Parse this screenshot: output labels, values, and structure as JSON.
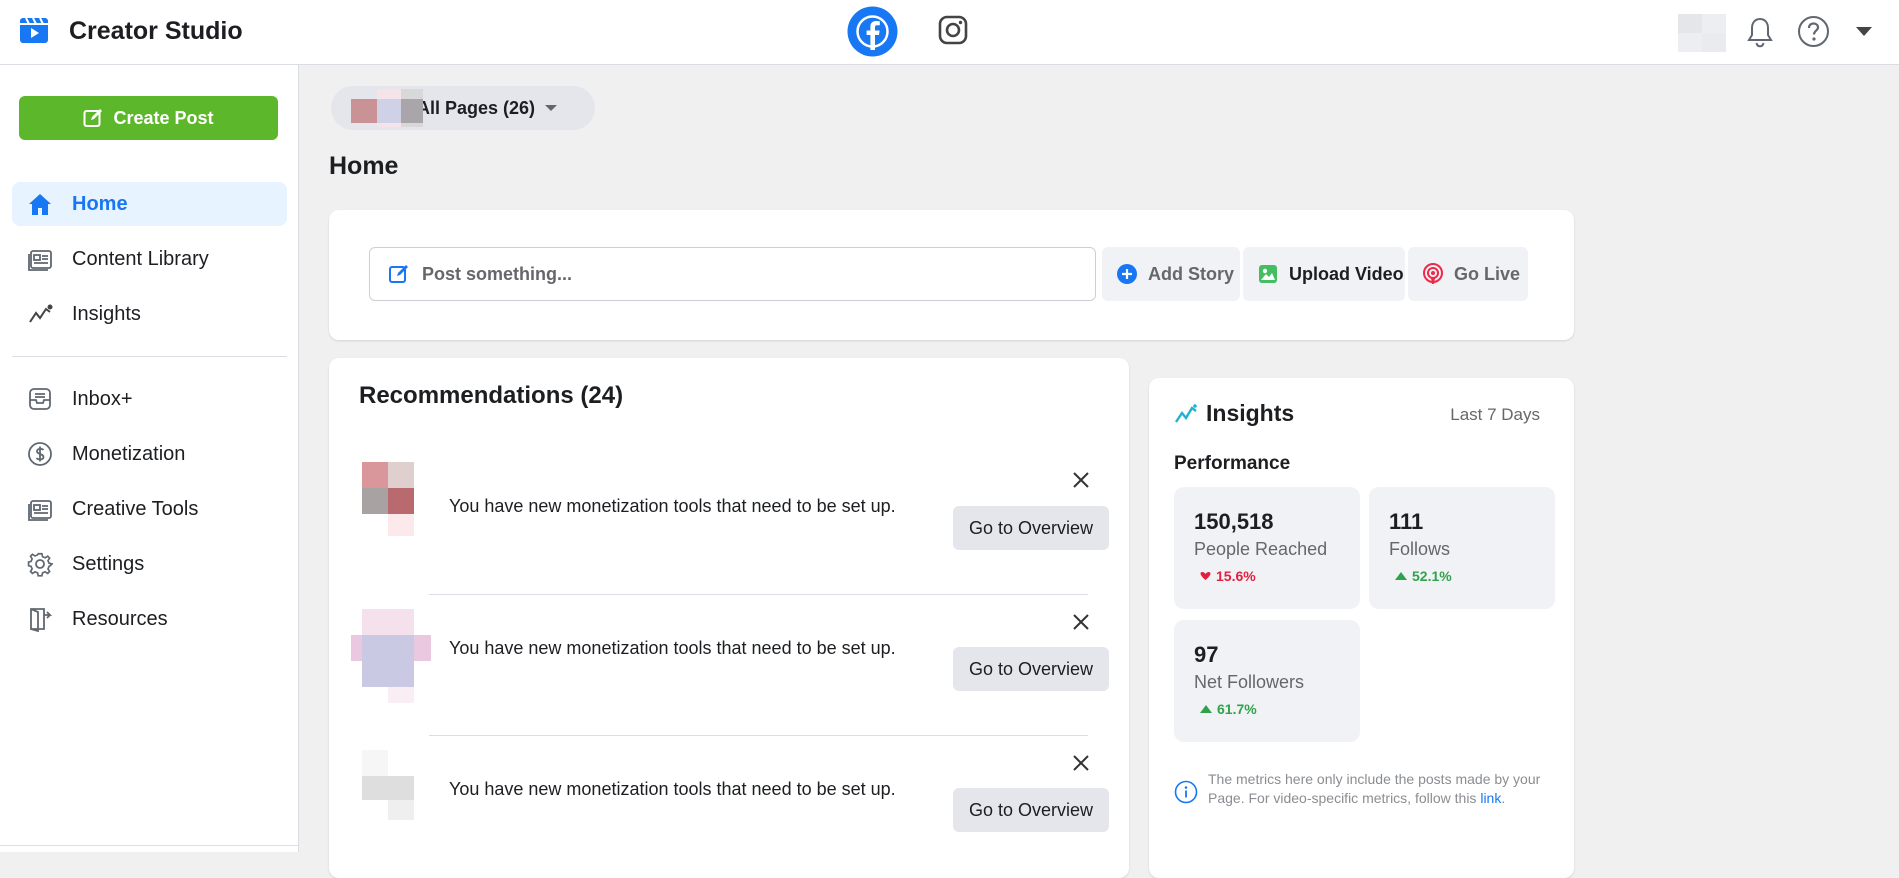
{
  "app": {
    "title": "Creator Studio"
  },
  "colors": {
    "accent": "#1877f2",
    "create": "#5cb82a",
    "down": "#e41e3f",
    "up": "#31a24c"
  },
  "topbar": {
    "platforms": [
      {
        "name": "Facebook",
        "icon": "facebook-icon",
        "active": true
      },
      {
        "name": "Instagram",
        "icon": "instagram-icon",
        "active": false
      }
    ],
    "icons": [
      "bell-icon",
      "help-icon",
      "caret-down-icon"
    ]
  },
  "sidebar": {
    "create_label": "Create Post",
    "items": [
      {
        "label": "Home",
        "icon": "home-icon",
        "active": true
      },
      {
        "label": "Content Library",
        "icon": "library-icon"
      },
      {
        "label": "Insights",
        "icon": "insights-icon"
      },
      {
        "label": "Inbox+",
        "icon": "inbox-icon"
      },
      {
        "label": "Monetization",
        "icon": "dollar-icon"
      },
      {
        "label": "Creative Tools",
        "icon": "creative-tools-icon"
      },
      {
        "label": "Settings",
        "icon": "settings-icon"
      },
      {
        "label": "Resources",
        "icon": "resources-icon"
      }
    ]
  },
  "page_selector": {
    "label": "All Pages (26)"
  },
  "main": {
    "title": "Home",
    "composer": {
      "placeholder": "Post something...",
      "add_story": "Add Story",
      "upload_video": "Upload Video",
      "go_live": "Go Live"
    },
    "recommendations": {
      "title": "Recommendations (24)",
      "items": [
        {
          "text": "You have new monetization tools that need to be set up.",
          "button": "Go to Overview"
        },
        {
          "text": "You have new monetization tools that need to be set up.",
          "button": "Go to Overview"
        },
        {
          "text": "You have new monetization tools that need to be set up.",
          "button": "Go to Overview"
        }
      ]
    },
    "insights": {
      "title": "Insights",
      "range": "Last 7 Days",
      "subtitle": "Performance",
      "metrics": [
        {
          "value": "150,518",
          "label": "People Reached",
          "change": "15.6%",
          "direction": "down"
        },
        {
          "value": "111",
          "label": "Follows",
          "change": "52.1%",
          "direction": "up"
        },
        {
          "value": "97",
          "label": "Net Followers",
          "change": "61.7%",
          "direction": "up"
        }
      ],
      "note": "The metrics here only include the posts made by your Page. For video-specific metrics, follow this",
      "note_link": "link"
    }
  }
}
